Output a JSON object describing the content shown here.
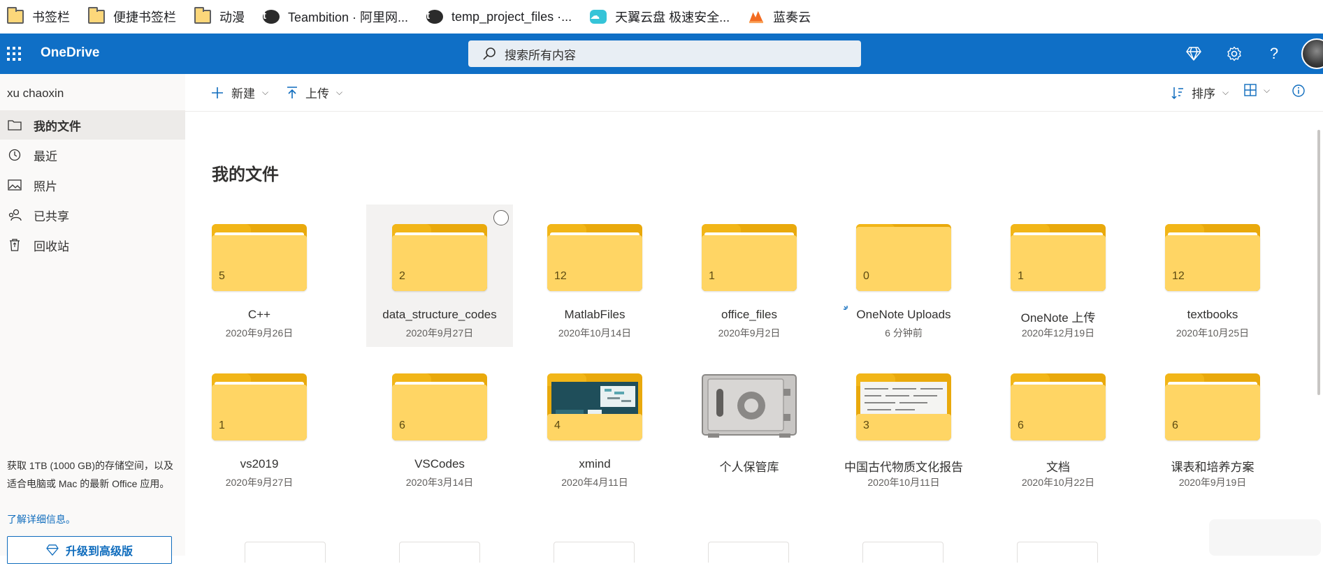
{
  "bookmarks": [
    {
      "label": "书签栏",
      "icon": "folder-icon"
    },
    {
      "label": "便捷书签栏",
      "icon": "folder-icon"
    },
    {
      "label": "动漫",
      "icon": "folder-icon"
    },
    {
      "label": "Teambition · 阿里网...",
      "icon": "teambition-icon"
    },
    {
      "label": "temp_project_files ·...",
      "icon": "teambition-icon"
    },
    {
      "label": "天翼云盘 极速安全...",
      "icon": "cloud-icon"
    },
    {
      "label": "蓝奏云",
      "icon": "lanzou-icon"
    }
  ],
  "appbar": {
    "brand": "OneDrive",
    "search_placeholder": "搜索所有内容",
    "bg_color": "#0f6fc6"
  },
  "sidebar": {
    "username": "xu chaoxin",
    "items": [
      {
        "label": "我的文件",
        "icon": "folder-outline-icon",
        "active": true
      },
      {
        "label": "最近",
        "icon": "history-icon",
        "active": false
      },
      {
        "label": "照片",
        "icon": "photo-icon",
        "active": false
      },
      {
        "label": "已共享",
        "icon": "people-icon",
        "active": false
      },
      {
        "label": "回收站",
        "icon": "recycle-bin-icon",
        "active": false
      }
    ],
    "promo_text": "获取 1TB (1000 GB)的存储空间，以及适合电脑或 Mac 的最新 Office 应用。",
    "promo_link": "了解详细信息。",
    "upgrade_label": "升级到高级版"
  },
  "commandbar": {
    "new_label": "新建",
    "upload_label": "上传",
    "sort_label": "排序"
  },
  "main": {
    "title": "我的文件",
    "items": [
      {
        "name": "C++",
        "date": "2020年9月26日",
        "count": "5",
        "type": "folder"
      },
      {
        "name": "data_structure_codes",
        "date": "2020年9月27日",
        "count": "2",
        "type": "folder",
        "selected": true
      },
      {
        "name": "MatlabFiles",
        "date": "2020年10月14日",
        "count": "12",
        "type": "folder"
      },
      {
        "name": "office_files",
        "date": "2020年9月2日",
        "count": "1",
        "type": "folder"
      },
      {
        "name": "OneNote Uploads",
        "date": "6 分钟前",
        "count": "0",
        "type": "folder",
        "syncing": true
      },
      {
        "name": "OneNote 上传",
        "date": "2020年12月19日",
        "count": "1",
        "type": "folder"
      },
      {
        "name": "textbooks",
        "date": "2020年10月25日",
        "count": "12",
        "type": "folder"
      },
      {
        "name": "vs2019",
        "date": "2020年9月27日",
        "count": "1",
        "type": "folder"
      },
      {
        "name": "VSCodes",
        "date": "2020年3月14日",
        "count": "6",
        "type": "folder"
      },
      {
        "name": "xmind",
        "date": "2020年4月11日",
        "count": "4",
        "type": "folder-preview-dark"
      },
      {
        "name": "个人保管库",
        "date": "",
        "count": "",
        "type": "vault"
      },
      {
        "name": "中国古代物质文化报告",
        "date": "2020年10月11日",
        "count": "3",
        "type": "folder-preview-paper"
      },
      {
        "name": "文档",
        "date": "2020年10月22日",
        "count": "6",
        "type": "folder"
      },
      {
        "name": "课表和培养方案",
        "date": "2020年9月19日",
        "count": "6",
        "type": "folder"
      }
    ]
  }
}
